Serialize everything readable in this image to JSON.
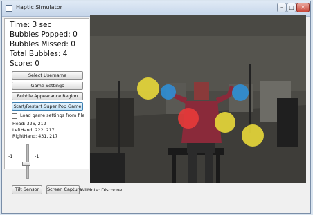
{
  "window": {
    "title": "Haptic Simulator"
  },
  "controls": {
    "minimize": "–",
    "maximize": "□",
    "close": "✕"
  },
  "stats": {
    "time": "Time: 3 sec",
    "popped": "Bubbles Popped: 0",
    "missed": "Bubbles Missed: 0",
    "total": "Total Bubbles: 4",
    "score": "Score: 0"
  },
  "buttons": {
    "select_username": "Select Username",
    "game_settings": "Game Settings",
    "bubble_region": "Bubble Appearance Region",
    "start_restart": "Start/Restart Super Pop Game"
  },
  "load_settings": {
    "label": "Load game settings from file",
    "checked": false
  },
  "positions": {
    "head": "Head: 326, 212",
    "left_hand": "LeftHand: 222, 217",
    "right_hand": "RightHand: 431, 217"
  },
  "tilt": {
    "min_label": "-1",
    "max_label": "-1"
  },
  "bottom": {
    "tilt_sensor": "Tilt Sensor",
    "screen_capture": "Screen Capture",
    "wiimote_status": "WiiMote: Disconnected"
  },
  "bubbles": [
    {
      "color": "#e8d83a"
    },
    {
      "color": "#2f8fd6"
    },
    {
      "color": "#e83a3a"
    },
    {
      "color": "#e8d83a"
    },
    {
      "color": "#2f8fd6"
    },
    {
      "color": "#e8d83a"
    }
  ]
}
